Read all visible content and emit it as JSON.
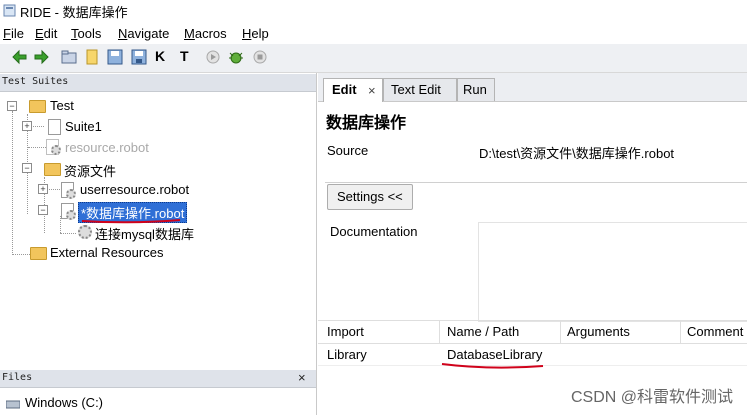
{
  "window": {
    "title": "RIDE - 数据库操作"
  },
  "menubar": {
    "items": [
      {
        "label": "File",
        "underline": "F",
        "rest": "ile"
      },
      {
        "label": "Edit",
        "underline": "E",
        "rest": "dit"
      },
      {
        "label": "Tools",
        "underline": "T",
        "rest": "ools"
      },
      {
        "label": "Navigate",
        "underline": "N",
        "rest": "avigate"
      },
      {
        "label": "Macros",
        "underline": "M",
        "rest": "acros"
      },
      {
        "label": "Help",
        "underline": "H",
        "rest": "elp"
      }
    ]
  },
  "toolbar": {
    "icons": [
      "back-icon",
      "forward-icon",
      "open-folder-icon",
      "new-file-icon",
      "save-icon",
      "save-all-icon",
      "keyword-search-icon",
      "test-search-icon",
      "run-icon",
      "debug-bug-icon",
      "stop-icon"
    ],
    "k_label": "K",
    "t_label": "T"
  },
  "left": {
    "header": "Test Suites",
    "tree": {
      "root": "Test",
      "suite1": "Suite1",
      "resource_robot": "resource.robot",
      "resource_folder": "资源文件",
      "userresource": "userresource.robot",
      "db_robot": "*数据库操作.robot",
      "db_keyword": "连接mysql数据库",
      "external": "External Resources"
    },
    "files_header": "Files",
    "files_close": "×",
    "drive": "Windows (C:)"
  },
  "right": {
    "tabs": [
      {
        "label": "Edit",
        "close": "×"
      },
      {
        "label": "Text Edit"
      },
      {
        "label": "Run"
      }
    ],
    "title": "数据库操作",
    "source_label": "Source",
    "source_value": "D:\\test\\资源文件\\数据库操作.robot",
    "settings_button": "Settings <<",
    "documentation_label": "Documentation",
    "grid": {
      "headers": [
        "Import",
        "Name / Path",
        "Arguments",
        "Comment"
      ],
      "rows": [
        [
          "Library",
          "DatabaseLibrary",
          "",
          ""
        ]
      ]
    }
  },
  "watermark": "CSDN @科雷软件测试",
  "colors": {
    "selection": "#2f6fd6",
    "underline_red": "#d0021b",
    "folder": "#f2c55c"
  }
}
